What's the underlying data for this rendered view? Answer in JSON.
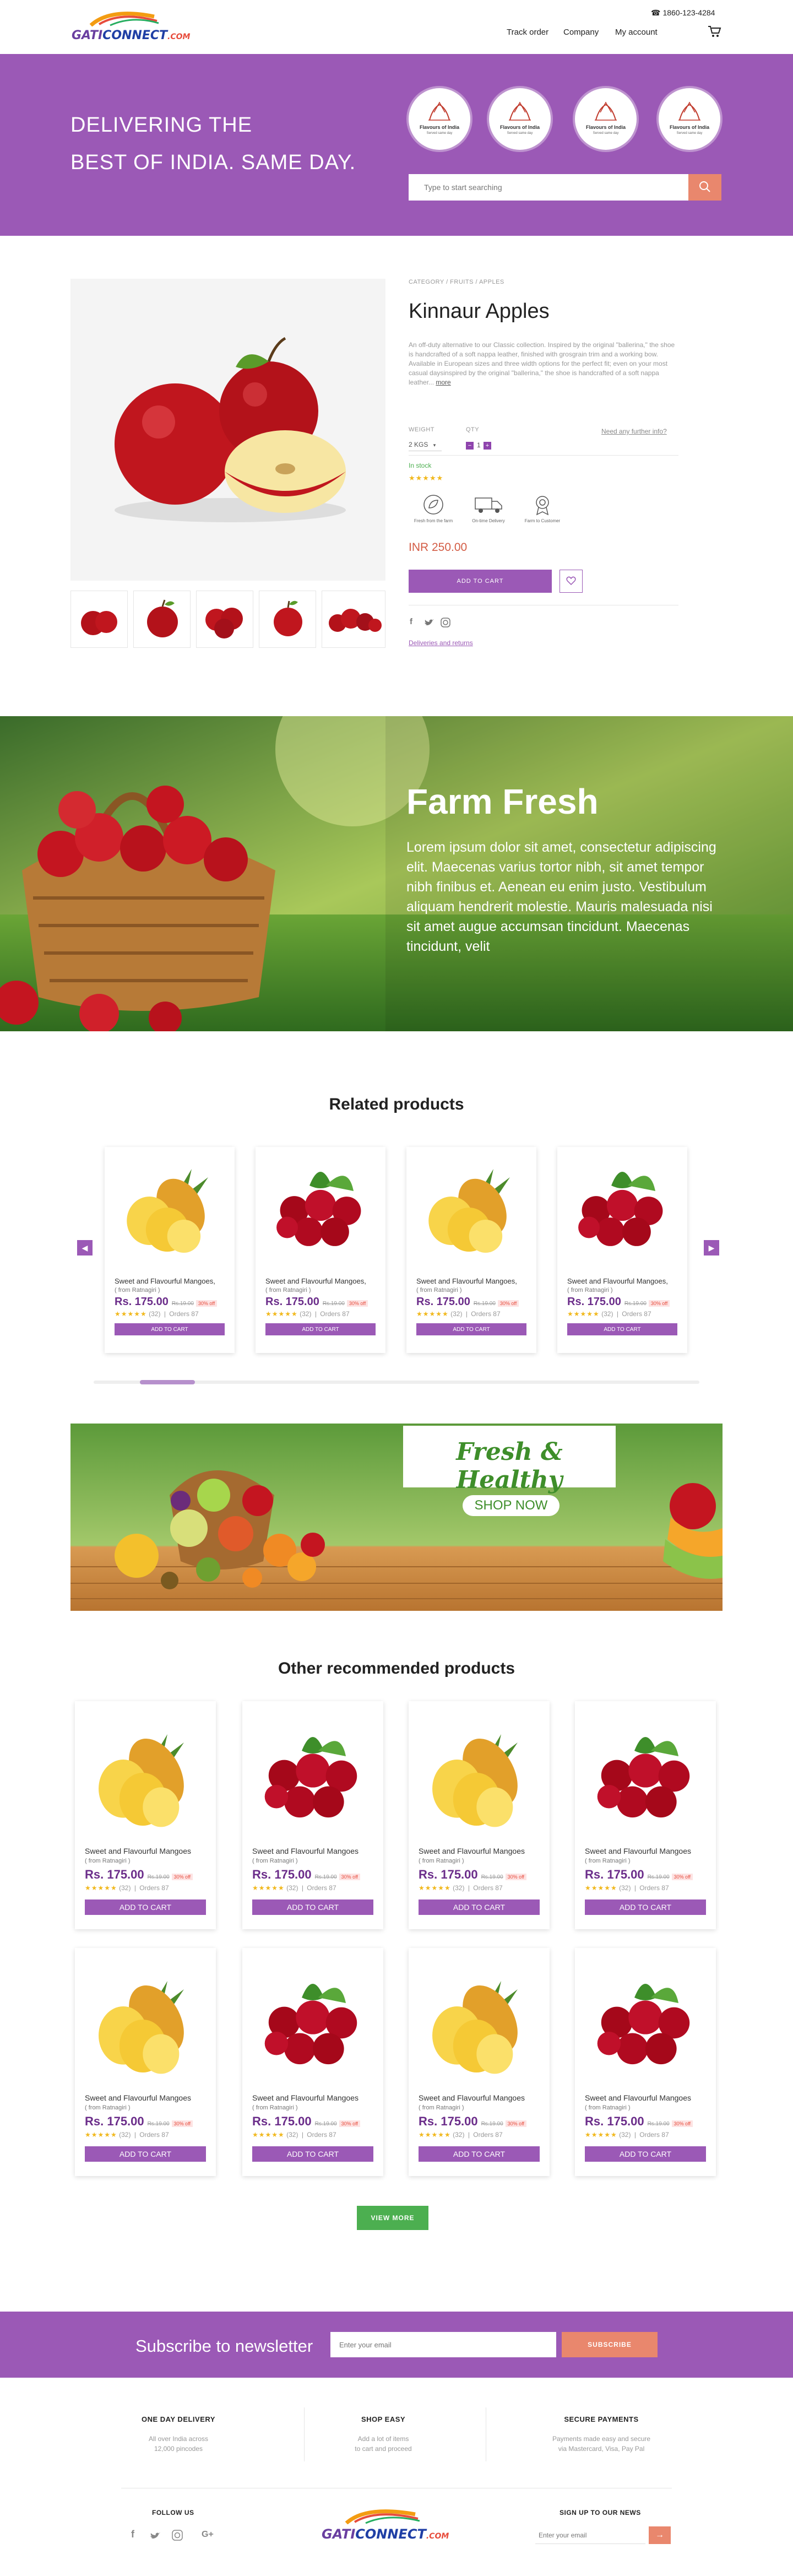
{
  "header": {
    "logo": {
      "part1": "GATI",
      "part2": "CONNECT",
      "part3": ".COM"
    },
    "phone": "1860-123-4284",
    "nav": [
      "Track order",
      "Company",
      "My account"
    ]
  },
  "hero": {
    "line1": "DELIVERING THE",
    "line2": "BEST OF INDIA. SAME DAY.",
    "badges": [
      {
        "title": "Flavours of India",
        "sub": "Served same day"
      },
      {
        "title": "Flavours of India",
        "sub": "Served same day"
      },
      {
        "title": "Flavours of India",
        "sub": "Served same day"
      },
      {
        "title": "Flavours of India",
        "sub": "Served same day"
      }
    ],
    "search_placeholder": "Type to start searching"
  },
  "product": {
    "breadcrumb": "CATEGORY  /  FRUITS  /  APPLES",
    "title": "Kinnaur Apples",
    "description": "An off-duty alternative to our Classic collection. Inspired by the original \"ballerina,\" the shoe is handcrafted of a soft nappa leather, finished with grosgrain trim and a working bow. Available in European sizes and three width options for the perfect fit; even on your most casual daysinspired by the original \"ballerina,\" the shoe is handcrafted of a soft nappa leather...",
    "more": "more",
    "weight_label": "WEIGHT",
    "weight_value": "2 KGS",
    "qty_label": "QTY",
    "qty_value": "1",
    "help_link": "Need any further info?",
    "stock": "In stock",
    "features": [
      "Fresh from the farm",
      "On-time Delivery",
      "Farm to Customer"
    ],
    "price": "INR 250.00",
    "add_to_cart": "ADD TO CART",
    "delivery_link": "Deliveries and returns"
  },
  "farm": {
    "title": "Farm Fresh",
    "text": "Lorem ipsum dolor sit amet, consectetur adipiscing elit. Maecenas varius tortor nibh, sit amet tempor nibh finibus et. Aenean eu enim justo. Vestibulum aliquam hendrerit molestie. Mauris malesuada nisi sit amet augue accumsan tincidunt. Maecenas tincidunt, velit"
  },
  "related": {
    "title": "Related products",
    "items": [
      {
        "name": "Sweet and Flavourful Mangoes,",
        "from": "( from Ratnagiri )",
        "price": "Rs. 175.00",
        "old": "Rs.19.00",
        "off": "30% off",
        "reviews": "(32)",
        "orders": "Orders 87",
        "button": "ADD TO CART",
        "fruit": "pineapple"
      },
      {
        "name": "Sweet and Flavourful Mangoes,",
        "from": "( from Ratnagiri )",
        "price": "Rs. 175.00",
        "old": "Rs.19.00",
        "off": "30% off",
        "reviews": "(32)",
        "orders": "Orders 87",
        "button": "ADD TO CART",
        "fruit": "cherry"
      },
      {
        "name": "Sweet and Flavourful Mangoes,",
        "from": "( from Ratnagiri )",
        "price": "Rs. 175.00",
        "old": "Rs.19.00",
        "off": "30% off",
        "reviews": "(32)",
        "orders": "Orders 87",
        "button": "ADD TO CART",
        "fruit": "pineapple"
      },
      {
        "name": "Sweet and Flavourful Mangoes,",
        "from": "( from Ratnagiri )",
        "price": "Rs. 175.00",
        "old": "Rs.19.00",
        "off": "30% off",
        "reviews": "(32)",
        "orders": "Orders 87",
        "button": "ADD TO CART",
        "fruit": "cherry"
      }
    ]
  },
  "banner": {
    "title": "Fresh & Healthy",
    "button": "SHOP NOW"
  },
  "recommended": {
    "title": "Other recommended products",
    "items": [
      {
        "name": "Sweet and Flavourful Mangoes",
        "from": "( from Ratnagiri )",
        "price": "Rs. 175.00",
        "old": "Rs.19.00",
        "off": "30% off",
        "reviews": "(32)",
        "orders": "Orders 87",
        "button": "ADD TO CART",
        "fruit": "pineapple"
      },
      {
        "name": "Sweet and Flavourful Mangoes",
        "from": "( from Ratnagiri )",
        "price": "Rs. 175.00",
        "old": "Rs.19.00",
        "off": "30% off",
        "reviews": "(32)",
        "orders": "Orders 87",
        "button": "ADD TO CART",
        "fruit": "cherry"
      },
      {
        "name": "Sweet and Flavourful Mangoes",
        "from": "( from Ratnagiri )",
        "price": "Rs. 175.00",
        "old": "Rs.19.00",
        "off": "30% off",
        "reviews": "(32)",
        "orders": "Orders 87",
        "button": "ADD TO CART",
        "fruit": "pineapple"
      },
      {
        "name": "Sweet and Flavourful Mangoes",
        "from": "( from Ratnagiri )",
        "price": "Rs. 175.00",
        "old": "Rs.19.00",
        "off": "30% off",
        "reviews": "(32)",
        "orders": "Orders 87",
        "button": "ADD TO CART",
        "fruit": "cherry"
      },
      {
        "name": "Sweet and Flavourful Mangoes",
        "from": "( from Ratnagiri )",
        "price": "Rs. 175.00",
        "old": "Rs.19.00",
        "off": "30% off",
        "reviews": "(32)",
        "orders": "Orders 87",
        "button": "ADD TO CART",
        "fruit": "pineapple"
      },
      {
        "name": "Sweet and Flavourful Mangoes",
        "from": "( from Ratnagiri )",
        "price": "Rs. 175.00",
        "old": "Rs.19.00",
        "off": "30% off",
        "reviews": "(32)",
        "orders": "Orders 87",
        "button": "ADD TO CART",
        "fruit": "cherry"
      },
      {
        "name": "Sweet and Flavourful Mangoes",
        "from": "( from Ratnagiri )",
        "price": "Rs. 175.00",
        "old": "Rs.19.00",
        "off": "30% off",
        "reviews": "(32)",
        "orders": "Orders 87",
        "button": "ADD TO CART",
        "fruit": "pineapple"
      },
      {
        "name": "Sweet and Flavourful Mangoes",
        "from": "( from Ratnagiri )",
        "price": "Rs. 175.00",
        "old": "Rs.19.00",
        "off": "30% off",
        "reviews": "(32)",
        "orders": "Orders 87",
        "button": "ADD TO CART",
        "fruit": "cherry"
      }
    ],
    "view_more": "VIEW MORE"
  },
  "newsletter": {
    "title": "Subscribe to newsletter",
    "placeholder": "Enter your email",
    "button": "SUBSCRIBE"
  },
  "footer": {
    "features": [
      {
        "title": "ONE DAY DELIVERY",
        "line1": "All over India across",
        "line2": "12,000 pincodes"
      },
      {
        "title": "SHOP EASY",
        "line1": "Add a lot of items",
        "line2": "to cart and proceed"
      },
      {
        "title": "SECURE PAYMENTS",
        "line1": "Payments made easy and secure",
        "line2": "via Mastercard, Visa, Pay Pal"
      }
    ],
    "follow": "FOLLOW US",
    "signup": "SIGN UP TO OUR NEWS",
    "email_placeholder": "Enter your email"
  },
  "colors": {
    "brand": "#9b59b6",
    "accent": "#e9876d",
    "price": "#6b2d8a",
    "stock": "#4caf50",
    "star": "#f1b81d"
  }
}
